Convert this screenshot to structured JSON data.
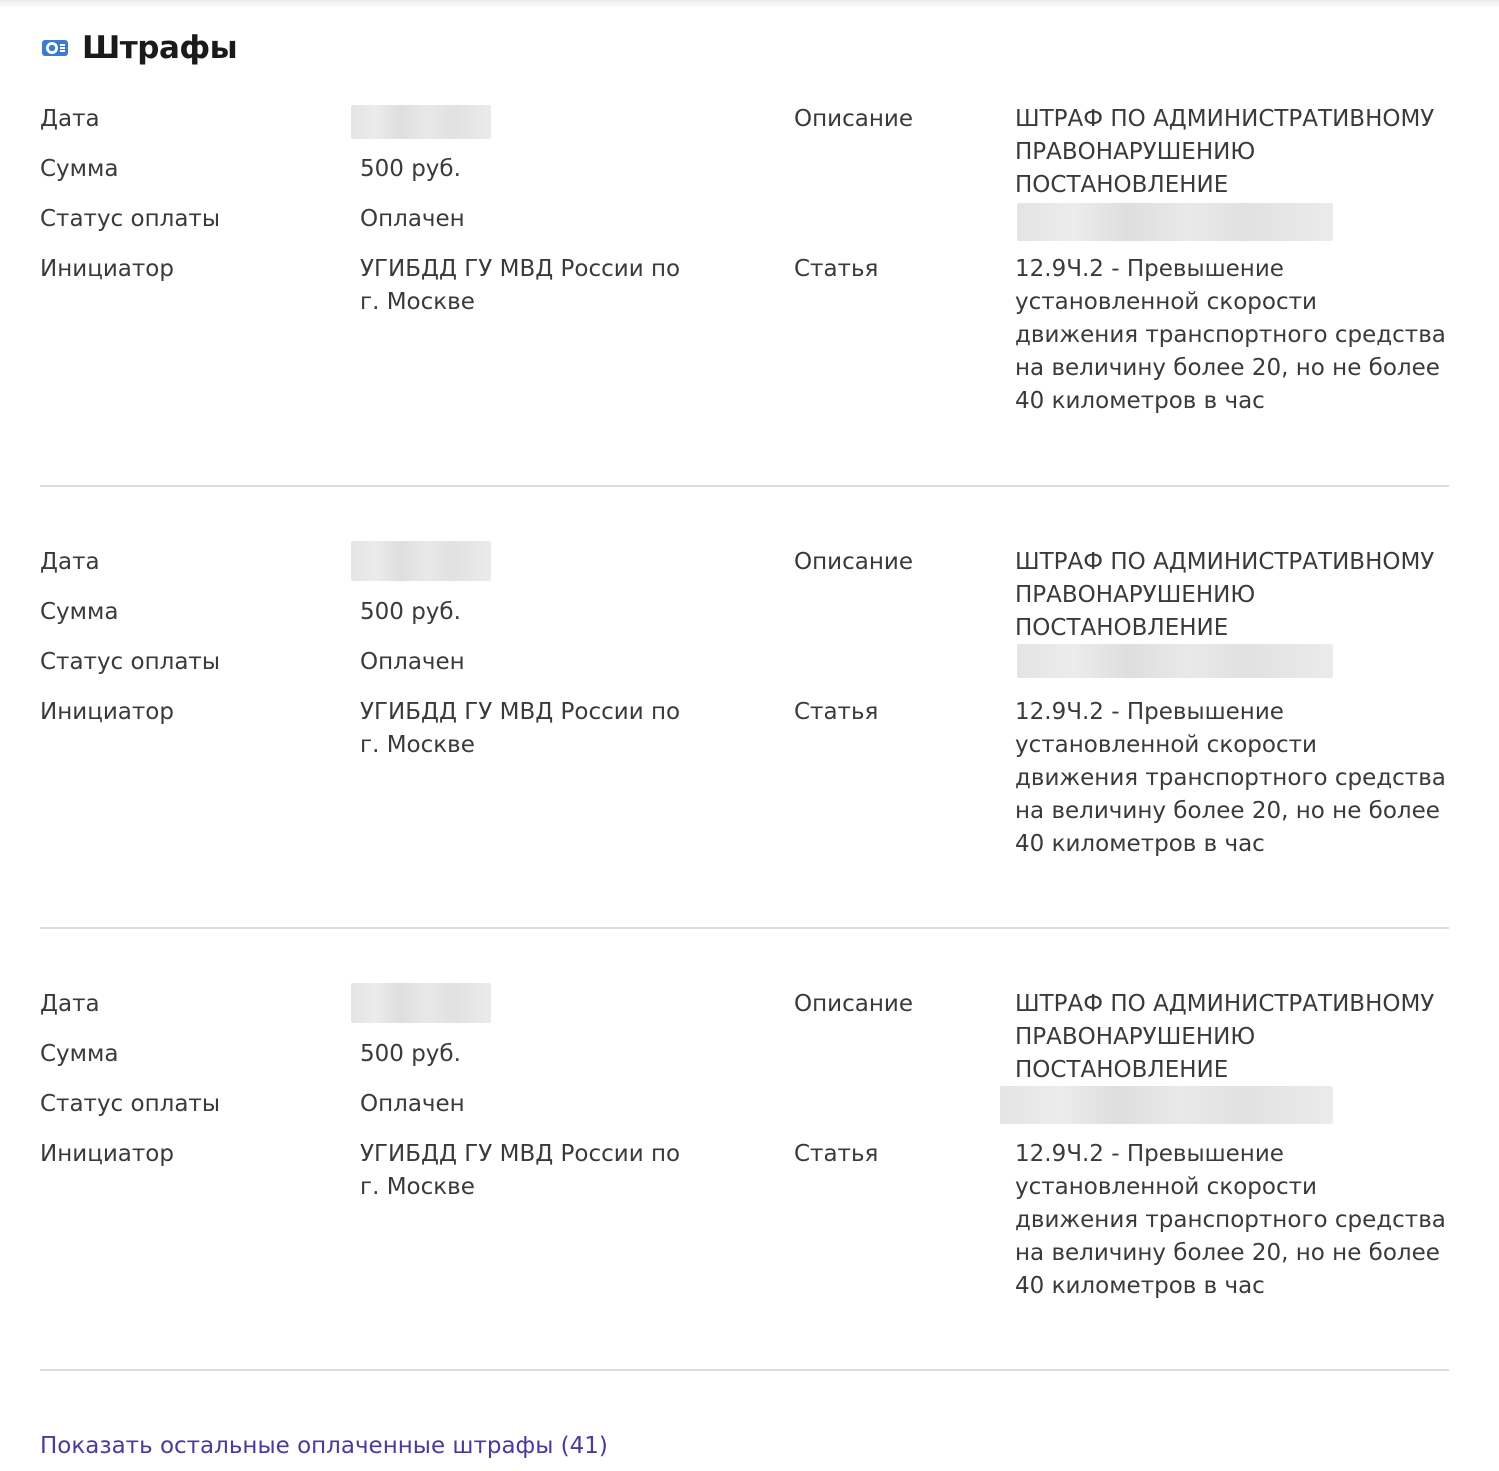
{
  "section": {
    "title": "Штрафы",
    "icon": "fines-icon"
  },
  "labels": {
    "date": "Дата",
    "amount": "Сумма",
    "payment_status": "Статус оплаты",
    "initiator": "Инициатор",
    "description": "Описание",
    "article": "Статья"
  },
  "fines": [
    {
      "amount": "500 руб.",
      "payment_status": "Оплачен",
      "initiator": "УГИБДД ГУ МВД России по г. Москве",
      "description": "ШТРАФ ПО АДМИНИСТРАТИВНОМУ ПРАВОНАРУШЕНИЮ ПОСТАНОВЛЕНИЕ",
      "article": "12.9Ч.2 - Превышение установленной скорости движения транспортного средства на величину более 20, но не более 40 километров в час"
    },
    {
      "amount": "500 руб.",
      "payment_status": "Оплачен",
      "initiator": "УГИБДД ГУ МВД России по г. Москве",
      "description": "ШТРАФ ПО АДМИНИСТРАТИВНОМУ ПРАВОНАРУШЕНИЮ ПОСТАНОВЛЕНИЕ",
      "article": "12.9Ч.2 - Превышение установленной скорости движения транспортного средства на величину более 20, но не более 40 километров в час"
    },
    {
      "amount": "500 руб.",
      "payment_status": "Оплачен",
      "initiator": "УГИБДД ГУ МВД России по г. Москве",
      "description": "ШТРАФ ПО АДМИНИСТРАТИВНОМУ ПРАВОНАРУШЕНИЮ ПОСТАНОВЛЕНИЕ",
      "article": "12.9Ч.2 - Превышение установленной скорости движения транспортного средства на величину более 20, но не более 40 километров в час"
    }
  ],
  "show_more": {
    "label": "Показать остальные оплаченные штрафы (41)"
  },
  "colors": {
    "accent": "#3a7bd5",
    "link": "#4a3a9a",
    "text": "#3a3a3a",
    "divider": "#dcdcdc"
  }
}
